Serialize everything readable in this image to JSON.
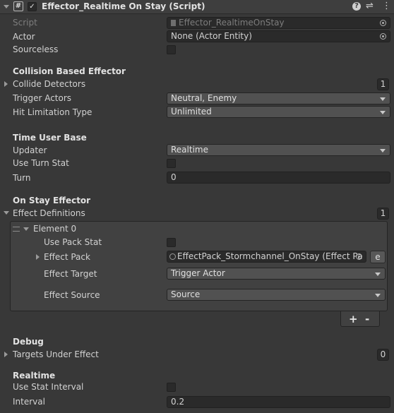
{
  "header": {
    "title": "Effector_Realtime On Stay (Script)",
    "script_badge": "#",
    "enabled_check": "✓",
    "help_icon": "?",
    "settings_icon": "⇌",
    "menu_icon": "⋮"
  },
  "fields": {
    "script_label": "Script",
    "script_value": "Effector_RealtimeOnStay",
    "actor_label": "Actor",
    "actor_value": "None (Actor Entity)",
    "sourceless_label": "Sourceless"
  },
  "collision": {
    "title": "Collision Based Effector",
    "collide_detectors_label": "Collide Detectors",
    "collide_detectors_count": "1",
    "trigger_actors_label": "Trigger Actors",
    "trigger_actors_value": "Neutral, Enemy",
    "hit_limitation_label": "Hit Limitation Type",
    "hit_limitation_value": "Unlimited"
  },
  "time_user": {
    "title": "Time User Base",
    "updater_label": "Updater",
    "updater_value": "Realtime",
    "use_turn_stat_label": "Use Turn Stat",
    "turn_label": "Turn",
    "turn_value": "0"
  },
  "on_stay": {
    "title": "On Stay Effector",
    "effect_definitions_label": "Effect Definitions",
    "effect_definitions_count": "1",
    "element_label": "Element 0",
    "use_pack_stat_label": "Use Pack Stat",
    "effect_pack_label": "Effect Pack",
    "effect_pack_value": "EffectPack_Stormchannel_OnStay (Effect Pa",
    "edit_button": "e",
    "effect_target_label": "Effect Target",
    "effect_target_value": "Trigger Actor",
    "effect_source_label": "Effect Source",
    "effect_source_value": "Source",
    "add_button": "+",
    "remove_button": "-"
  },
  "debug": {
    "title": "Debug",
    "targets_label": "Targets Under Effect",
    "targets_count": "0"
  },
  "realtime": {
    "title": "Realtime",
    "use_stat_interval_label": "Use Stat Interval",
    "interval_label": "Interval",
    "interval_value": "0.2"
  }
}
